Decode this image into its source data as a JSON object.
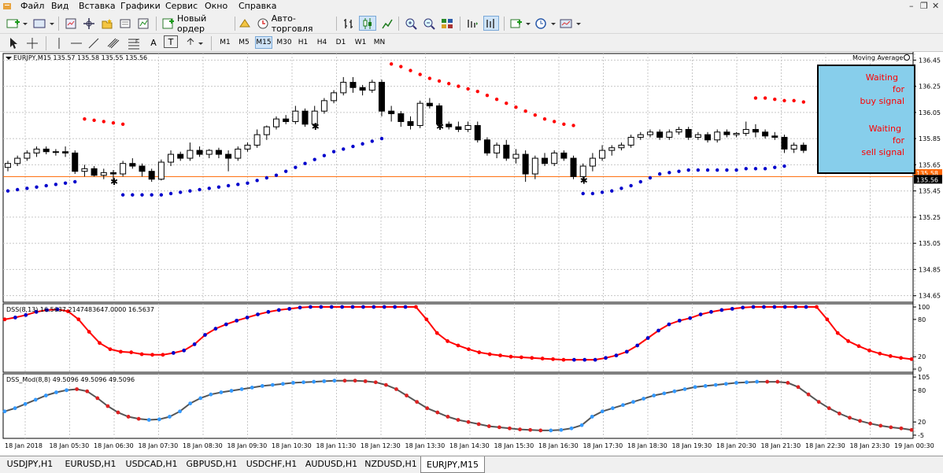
{
  "menu": {
    "items": [
      "Файл",
      "Вид",
      "Вставка",
      "Графики",
      "Сервис",
      "Окно",
      "Справка"
    ]
  },
  "toolbar": {
    "new_order_label": "Новый ордер",
    "autotrading_label": "Авто-торговля",
    "drawing_tools": [
      "A",
      "T"
    ],
    "timeframes": [
      "M1",
      "M5",
      "M15",
      "M30",
      "H1",
      "H4",
      "D1",
      "W1",
      "MN"
    ],
    "active_timeframe": "M15"
  },
  "chart": {
    "main_title": "EURJPY,M15  135.57 135.58 135.55 135.56",
    "indicator_label": "Moving Average",
    "current_price": "135.56",
    "prev_price_label": "135.58",
    "signal_box": {
      "line1": "Waiting",
      "line2": "for",
      "line3": "buy signal",
      "line4": "Waiting",
      "line5": "for",
      "line6": "sell signal"
    },
    "dss_title": "DSS(8,13) 16.5637 2147483647.0000 16.5637",
    "dss_mod_title": "DSS_Mod(8,8) 49.5096 49.5096 49.5096",
    "dss_levels": [
      "100",
      "80",
      "20",
      "0"
    ],
    "dss_mod_levels": [
      "105",
      "80",
      "20",
      "-5"
    ]
  },
  "tabs": [
    "USDJPY,H1",
    "EURUSD,H1",
    "USDCAD,H1",
    "GBPUSD,H1",
    "USDCHF,H1",
    "AUDUSD,H1",
    "NZDUSD,H1",
    "EURJPY,M15"
  ],
  "active_tab": "EURJPY,M15",
  "colors": {
    "bull_dot": "#0000cc",
    "bear_dot": "#ff0000",
    "dss_line": "#ff0000",
    "dss_mod_line": "#555555",
    "dss_mod_up_dot": "#3399ff",
    "dss_mod_dn_dot": "#dd2222",
    "price_line": "#ff6600",
    "signal_bg": "#87ceeb",
    "signal_text": "#ff0000"
  },
  "chart_data": [
    {
      "type": "candlestick",
      "title": "EURJPY,M15  135.57 135.58 135.55 135.56",
      "y_ticks": [
        136.45,
        136.25,
        136.05,
        135.85,
        135.65,
        135.45,
        135.25,
        135.05,
        134.85,
        134.65
      ],
      "x_tick_labels": [
        "18 Jan 2018",
        "18 Jan 05:30",
        "18 Jan 06:30",
        "18 Jan 07:30",
        "18 Jan 08:30",
        "18 Jan 09:30",
        "18 Jan 10:30",
        "18 Jan 11:30",
        "18 Jan 12:30",
        "18 Jan 13:30",
        "18 Jan 14:30",
        "18 Jan 15:30",
        "18 Jan 16:30",
        "18 Jan 17:30",
        "18 Jan 18:30",
        "18 Jan 19:30",
        "18 Jan 20:30",
        "18 Jan 21:30",
        "18 Jan 22:30",
        "18 Jan 23:30",
        "19 Jan 00:30"
      ],
      "ylim": [
        134.6,
        136.5
      ],
      "candles": [
        [
          135.63,
          135.68,
          135.6,
          135.66
        ],
        [
          135.66,
          135.72,
          135.64,
          135.7
        ],
        [
          135.7,
          135.76,
          135.68,
          135.74
        ],
        [
          135.74,
          135.79,
          135.71,
          135.77
        ],
        [
          135.77,
          135.79,
          135.73,
          135.75
        ],
        [
          135.75,
          135.77,
          135.72,
          135.75
        ],
        [
          135.75,
          135.79,
          135.71,
          135.74
        ],
        [
          135.74,
          135.76,
          135.58,
          135.6
        ],
        [
          135.6,
          135.65,
          135.56,
          135.62
        ],
        [
          135.62,
          135.64,
          135.56,
          135.57
        ],
        [
          135.57,
          135.62,
          135.54,
          135.59
        ],
        [
          135.59,
          135.61,
          135.52,
          135.58
        ],
        [
          135.58,
          135.68,
          135.56,
          135.66
        ],
        [
          135.66,
          135.7,
          135.62,
          135.64
        ],
        [
          135.64,
          135.66,
          135.56,
          135.6
        ],
        [
          135.6,
          135.62,
          135.52,
          135.54
        ],
        [
          135.54,
          135.69,
          135.53,
          135.67
        ],
        [
          135.67,
          135.76,
          135.64,
          135.73
        ],
        [
          135.73,
          135.75,
          135.68,
          135.7
        ],
        [
          135.7,
          135.82,
          135.68,
          135.76
        ],
        [
          135.76,
          135.79,
          135.71,
          135.73
        ],
        [
          135.73,
          135.77,
          135.7,
          135.76
        ],
        [
          135.76,
          135.78,
          135.7,
          135.73
        ],
        [
          135.73,
          135.76,
          135.6,
          135.7
        ],
        [
          135.7,
          135.79,
          135.68,
          135.77
        ],
        [
          135.77,
          135.82,
          135.75,
          135.8
        ],
        [
          135.8,
          135.92,
          135.78,
          135.88
        ],
        [
          135.88,
          135.95,
          135.84,
          135.94
        ],
        [
          135.94,
          136.02,
          135.92,
          136.0
        ],
        [
          136.0,
          136.03,
          135.96,
          135.98
        ],
        [
          135.98,
          136.1,
          135.96,
          136.06
        ],
        [
          136.06,
          136.08,
          135.94,
          135.96
        ],
        [
          135.96,
          136.1,
          135.94,
          136.06
        ],
        [
          136.06,
          136.16,
          136.04,
          136.14
        ],
        [
          136.14,
          136.22,
          136.12,
          136.2
        ],
        [
          136.2,
          136.32,
          136.18,
          136.28
        ],
        [
          136.28,
          136.32,
          136.2,
          136.24
        ],
        [
          136.24,
          136.26,
          136.18,
          136.22
        ],
        [
          136.22,
          136.3,
          136.2,
          136.28
        ],
        [
          136.28,
          136.3,
          136.02,
          136.06
        ],
        [
          136.06,
          136.1,
          135.98,
          136.04
        ],
        [
          136.04,
          136.06,
          135.94,
          135.98
        ],
        [
          135.98,
          136.02,
          135.92,
          135.95
        ],
        [
          135.95,
          136.14,
          135.93,
          136.12
        ],
        [
          136.12,
          136.16,
          136.08,
          136.1
        ],
        [
          136.1,
          136.12,
          135.94,
          135.96
        ],
        [
          135.96,
          135.98,
          135.92,
          135.94
        ],
        [
          135.94,
          135.98,
          135.9,
          135.92
        ],
        [
          135.92,
          135.98,
          135.9,
          135.95
        ],
        [
          135.95,
          135.98,
          135.82,
          135.84
        ],
        [
          135.84,
          135.86,
          135.72,
          135.74
        ],
        [
          135.74,
          135.82,
          135.7,
          135.8
        ],
        [
          135.8,
          135.84,
          135.68,
          135.7
        ],
        [
          135.7,
          135.77,
          135.66,
          135.73
        ],
        [
          135.73,
          135.76,
          135.52,
          135.58
        ],
        [
          135.58,
          135.72,
          135.54,
          135.7
        ],
        [
          135.7,
          135.74,
          135.64,
          135.66
        ],
        [
          135.66,
          135.76,
          135.64,
          135.74
        ],
        [
          135.74,
          135.76,
          135.68,
          135.7
        ],
        [
          135.7,
          135.72,
          135.54,
          135.56
        ],
        [
          135.56,
          135.66,
          135.53,
          135.64
        ],
        [
          135.64,
          135.74,
          135.6,
          135.7
        ],
        [
          135.7,
          135.8,
          135.68,
          135.76
        ],
        [
          135.76,
          135.8,
          135.72,
          135.78
        ],
        [
          135.78,
          135.82,
          135.76,
          135.8
        ],
        [
          135.8,
          135.88,
          135.78,
          135.86
        ],
        [
          135.86,
          135.9,
          135.84,
          135.88
        ],
        [
          135.88,
          135.92,
          135.86,
          135.9
        ],
        [
          135.9,
          135.92,
          135.84,
          135.86
        ],
        [
          135.86,
          135.92,
          135.84,
          135.9
        ],
        [
          135.9,
          135.94,
          135.88,
          135.92
        ],
        [
          135.92,
          135.94,
          135.84,
          135.86
        ],
        [
          135.86,
          135.9,
          135.84,
          135.88
        ],
        [
          135.88,
          135.9,
          135.82,
          135.84
        ],
        [
          135.84,
          135.92,
          135.82,
          135.9
        ],
        [
          135.9,
          135.92,
          135.86,
          135.88
        ],
        [
          135.88,
          135.9,
          135.86,
          135.89
        ],
        [
          135.89,
          135.98,
          135.87,
          135.92
        ],
        [
          135.92,
          135.96,
          135.86,
          135.9
        ],
        [
          135.9,
          135.92,
          135.85,
          135.87
        ],
        [
          135.87,
          135.9,
          135.84,
          135.86
        ],
        [
          135.86,
          135.88,
          135.74,
          135.77
        ],
        [
          135.77,
          135.82,
          135.74,
          135.8
        ],
        [
          135.8,
          135.82,
          135.74,
          135.76
        ]
      ],
      "bull_dots": [
        135.45,
        135.46,
        135.47,
        135.48,
        135.49,
        135.5,
        135.51,
        135.52,
        null,
        null,
        null,
        null,
        135.42,
        135.42,
        135.42,
        135.42,
        135.42,
        135.43,
        135.44,
        135.45,
        135.46,
        135.47,
        135.48,
        135.49,
        135.5,
        135.51,
        135.53,
        135.55,
        135.57,
        135.6,
        135.63,
        135.66,
        135.69,
        135.72,
        135.75,
        135.77,
        135.79,
        135.81,
        135.83,
        135.85,
        null,
        null,
        null,
        null,
        null,
        null,
        null,
        null,
        null,
        null,
        null,
        null,
        null,
        null,
        null,
        null,
        null,
        null,
        null,
        null,
        135.43,
        135.43,
        135.44,
        135.45,
        135.47,
        135.49,
        135.52,
        135.55,
        135.58,
        135.59,
        135.6,
        135.61,
        135.61,
        135.61,
        135.61,
        135.61,
        135.61,
        135.62,
        135.62,
        135.62,
        135.63,
        135.64,
        null,
        null
      ],
      "bear_dots": [
        null,
        null,
        null,
        null,
        null,
        null,
        null,
        null,
        136.0,
        135.99,
        135.98,
        135.97,
        135.96,
        null,
        null,
        null,
        null,
        null,
        null,
        null,
        null,
        null,
        null,
        null,
        null,
        null,
        null,
        null,
        null,
        null,
        null,
        null,
        null,
        null,
        null,
        null,
        null,
        null,
        null,
        null,
        136.42,
        136.4,
        136.37,
        136.34,
        136.31,
        136.29,
        136.27,
        136.25,
        136.23,
        136.21,
        136.18,
        136.15,
        136.12,
        136.09,
        136.06,
        136.03,
        136.0,
        135.98,
        135.96,
        135.95,
        null,
        null,
        null,
        null,
        null,
        null,
        null,
        null,
        null,
        null,
        null,
        null,
        null,
        null,
        null,
        null,
        null,
        null,
        136.16,
        136.16,
        136.15,
        136.14,
        136.14,
        136.13
      ]
    },
    {
      "type": "line",
      "title": "DSS(8,13) 16.5637 2147483647.0000 16.5637",
      "ylim": [
        0,
        100
      ],
      "y_ticks": [
        100,
        80,
        20,
        0
      ],
      "values": [
        80,
        83,
        87,
        92,
        95,
        96,
        93,
        80,
        60,
        42,
        32,
        28,
        27,
        24,
        23,
        23,
        26,
        30,
        40,
        55,
        65,
        72,
        78,
        83,
        88,
        92,
        95,
        97,
        99,
        100,
        100,
        100,
        100,
        100,
        100,
        100,
        100,
        100,
        100,
        100,
        80,
        58,
        45,
        38,
        32,
        27,
        24,
        22,
        20,
        19,
        18,
        17,
        16,
        15,
        15,
        15,
        15,
        18,
        22,
        28,
        38,
        50,
        62,
        72,
        78,
        82,
        88,
        92,
        95,
        97,
        99,
        100,
        100,
        100,
        100,
        100,
        100,
        100,
        80,
        58,
        45,
        37,
        30,
        25,
        21,
        18,
        16
      ],
      "direction_up": [
        0,
        1,
        1,
        1,
        1,
        1,
        0,
        0,
        0,
        0,
        0,
        0,
        0,
        0,
        0,
        0,
        1,
        1,
        1,
        1,
        1,
        1,
        1,
        1,
        1,
        1,
        1,
        1,
        1,
        1,
        1,
        1,
        1,
        1,
        1,
        1,
        1,
        1,
        1,
        0,
        0,
        0,
        0,
        0,
        0,
        0,
        0,
        0,
        0,
        0,
        0,
        0,
        0,
        0,
        1,
        1,
        1,
        1,
        1,
        1,
        1,
        1,
        1,
        1,
        1,
        1,
        1,
        1,
        1,
        1,
        1,
        1,
        1,
        1,
        1,
        1,
        1,
        0,
        0,
        0,
        0,
        0,
        0,
        0,
        0,
        0
      ]
    },
    {
      "type": "line",
      "title": "DSS_Mod(8,8) 49.5096 49.5096 49.5096",
      "ylim": [
        -5,
        105
      ],
      "y_ticks": [
        105,
        80,
        20,
        -5
      ],
      "values": [
        40,
        46,
        54,
        62,
        70,
        76,
        80,
        82,
        78,
        65,
        50,
        38,
        30,
        26,
        24,
        25,
        30,
        40,
        55,
        65,
        72,
        76,
        79,
        82,
        85,
        88,
        90,
        92,
        94,
        95,
        96,
        97,
        98,
        98,
        98,
        97,
        95,
        90,
        82,
        70,
        58,
        46,
        38,
        30,
        24,
        20,
        16,
        12,
        10,
        8,
        6,
        5,
        4,
        4,
        5,
        8,
        14,
        30,
        40,
        46,
        52,
        58,
        64,
        70,
        74,
        78,
        82,
        86,
        88,
        90,
        92,
        94,
        95,
        96,
        96,
        96,
        94,
        86,
        72,
        58,
        46,
        36,
        28,
        22,
        17,
        13,
        10,
        8,
        5
      ],
      "direction_up": [
        1,
        1,
        1,
        1,
        1,
        1,
        1,
        0,
        0,
        0,
        0,
        0,
        0,
        0,
        1,
        1,
        1,
        1,
        1,
        1,
        1,
        1,
        1,
        1,
        1,
        1,
        1,
        1,
        1,
        1,
        1,
        1,
        1,
        0,
        0,
        0,
        0,
        0,
        0,
        0,
        0,
        0,
        0,
        0,
        0,
        0,
        0,
        0,
        0,
        0,
        0,
        0,
        0,
        1,
        1,
        1,
        1,
        1,
        1,
        1,
        1,
        1,
        1,
        1,
        1,
        1,
        1,
        1,
        1,
        1,
        1,
        1,
        1,
        1,
        0,
        0,
        0,
        0,
        0,
        0,
        0,
        0,
        0,
        0,
        0,
        0,
        0,
        0
      ]
    }
  ]
}
